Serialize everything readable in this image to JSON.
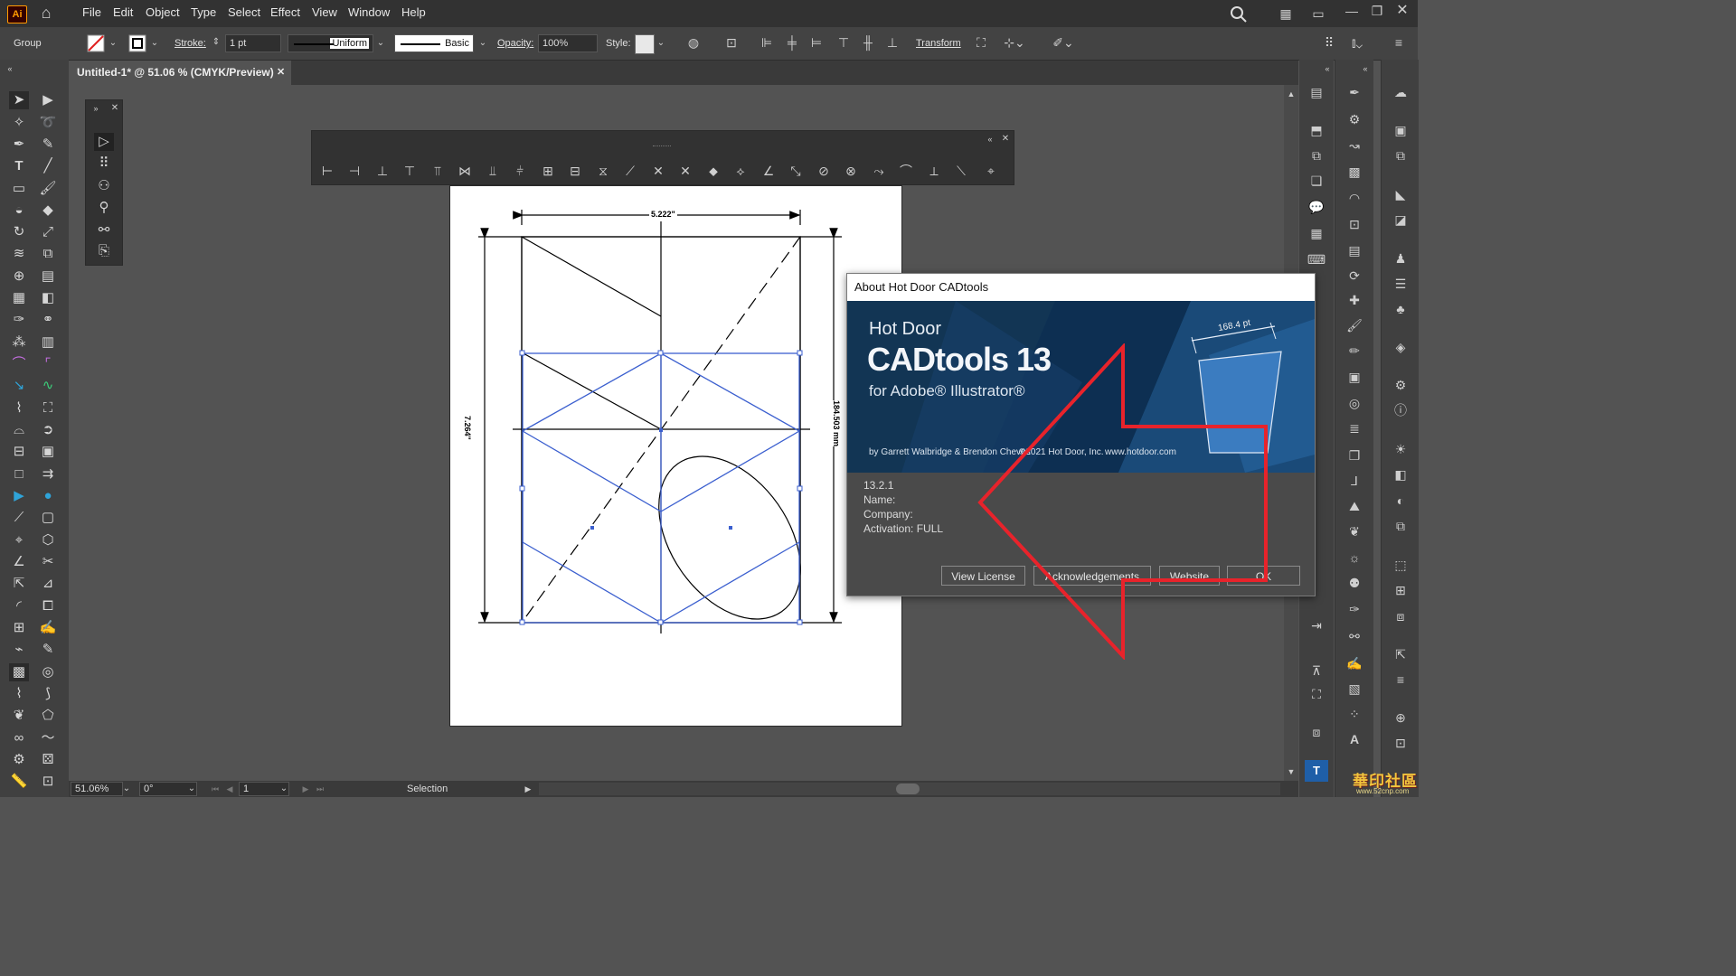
{
  "app": {
    "logo_text": "Ai",
    "brand_color": "#ff9a00"
  },
  "menu": {
    "items": [
      "File",
      "Edit",
      "Object",
      "Type",
      "Select",
      "Effect",
      "View",
      "Window",
      "Help"
    ]
  },
  "control_bar": {
    "selection_label": "Group",
    "stroke_label": "Stroke:",
    "stroke_weight": "1 pt",
    "profile_uniform": "Uniform",
    "brush_basic": "Basic",
    "opacity_label": "Opacity:",
    "opacity_value": "100%",
    "style_label": "Style:",
    "transform_label": "Transform"
  },
  "document": {
    "tab_title": "Untitled-1* @ 51.06 % (CMYK/Preview)",
    "close_glyph": "✕"
  },
  "drawing": {
    "dim_top": "5.222\"",
    "dim_left": "7.264\"",
    "dim_right": "184.503 mm"
  },
  "dialog": {
    "title": "About Hot Door CADtools",
    "brand_small": "Hot Door",
    "brand_large": "CADtools 13",
    "brand_sub": "for Adobe® Illustrator®",
    "banner_dimension": "168.4 pt",
    "credits": "by Garrett Walbridge & Brendon Cheves",
    "copyright": "©2021 Hot Door, Inc.",
    "website_url": "www.hotdoor.com",
    "version": "13.2.1",
    "name_label": "Name:",
    "company_label": "Company:",
    "activation_label": "Activation: FULL",
    "buttons": {
      "view_license": "View License",
      "acknowledgements": "Acknowledgements",
      "website": "Website",
      "ok": "OK"
    }
  },
  "status": {
    "zoom": "51.06%",
    "rotation": "0°",
    "artboard_number": "1",
    "tool_name": "Selection"
  },
  "watermark": {
    "text": "華印社區",
    "sub": "www.52cnp.com"
  },
  "colors": {
    "selection_blue": "#3b5fcf",
    "annotation_red": "#e8232b",
    "banner_blue": "#0f3a63"
  }
}
